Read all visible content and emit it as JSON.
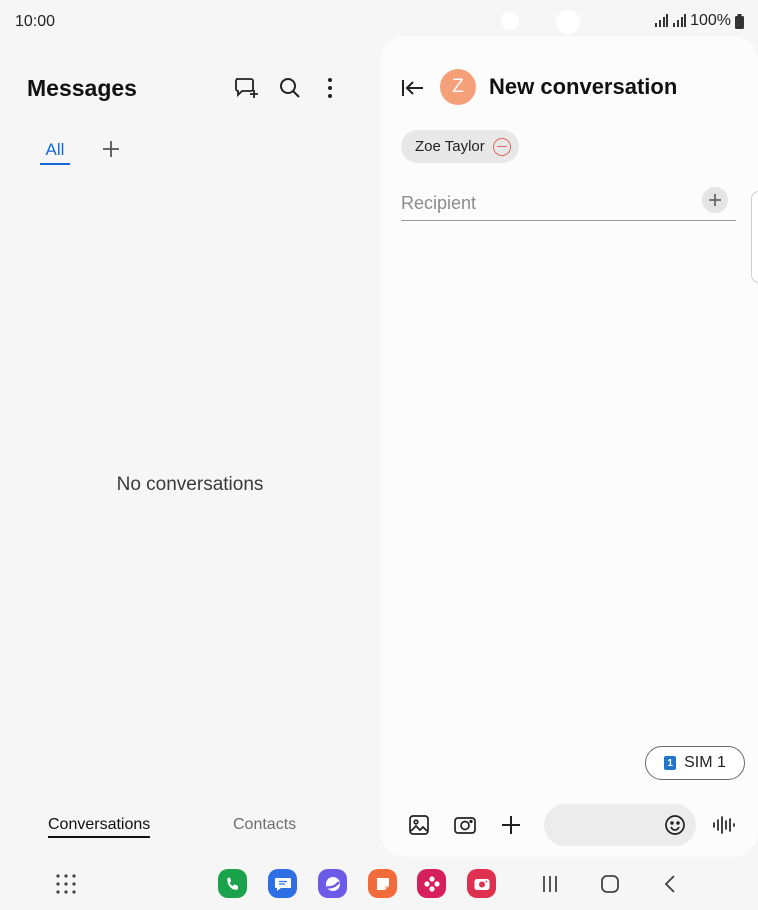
{
  "status_bar": {
    "time": "10:00",
    "battery": "100%",
    "icons": [
      "signal-icon",
      "signal-icon",
      "battery-icon"
    ]
  },
  "messages_pane": {
    "title": "Messages",
    "header_icons": [
      "new-chat-icon",
      "search-icon",
      "more-vertical-icon"
    ],
    "tabs": [
      {
        "label": "All",
        "selected": true
      }
    ],
    "add_tab_icon": "plus-icon",
    "empty_state": "No conversations",
    "bottom_tabs": [
      {
        "label": "Conversations",
        "selected": true
      },
      {
        "label": "Contacts",
        "selected": false
      }
    ]
  },
  "new_conversation": {
    "back_icon": "collapse-left-icon",
    "avatar_initial": "Z",
    "title": "New conversation",
    "recipient_chip": "Zoe Taylor",
    "recipient_placeholder": "Recipient",
    "sim": {
      "badge": "1",
      "label": "SIM 1"
    },
    "composer_icons": [
      "gallery-icon",
      "camera-icon",
      "plus-icon",
      "emoji-icon",
      "voice-icon"
    ]
  },
  "nav_bar": {
    "dock_apps": [
      {
        "name": "phone-app-icon",
        "color": "#1aa34a"
      },
      {
        "name": "messages-app-icon",
        "color": "#2f6fe4"
      },
      {
        "name": "internet-app-icon",
        "color": "#6b5be6"
      },
      {
        "name": "notes-app-icon",
        "color": "#f26b3a"
      },
      {
        "name": "gallery-app-icon",
        "color": "#d61f5d"
      },
      {
        "name": "camera-app-icon",
        "color": "#e0304f"
      }
    ],
    "buttons": [
      "recents-icon",
      "home-icon",
      "back-icon"
    ]
  },
  "colors": {
    "accent": "#1668d6",
    "avatar": "#f5a078",
    "chip_remove": "#e0675a"
  }
}
